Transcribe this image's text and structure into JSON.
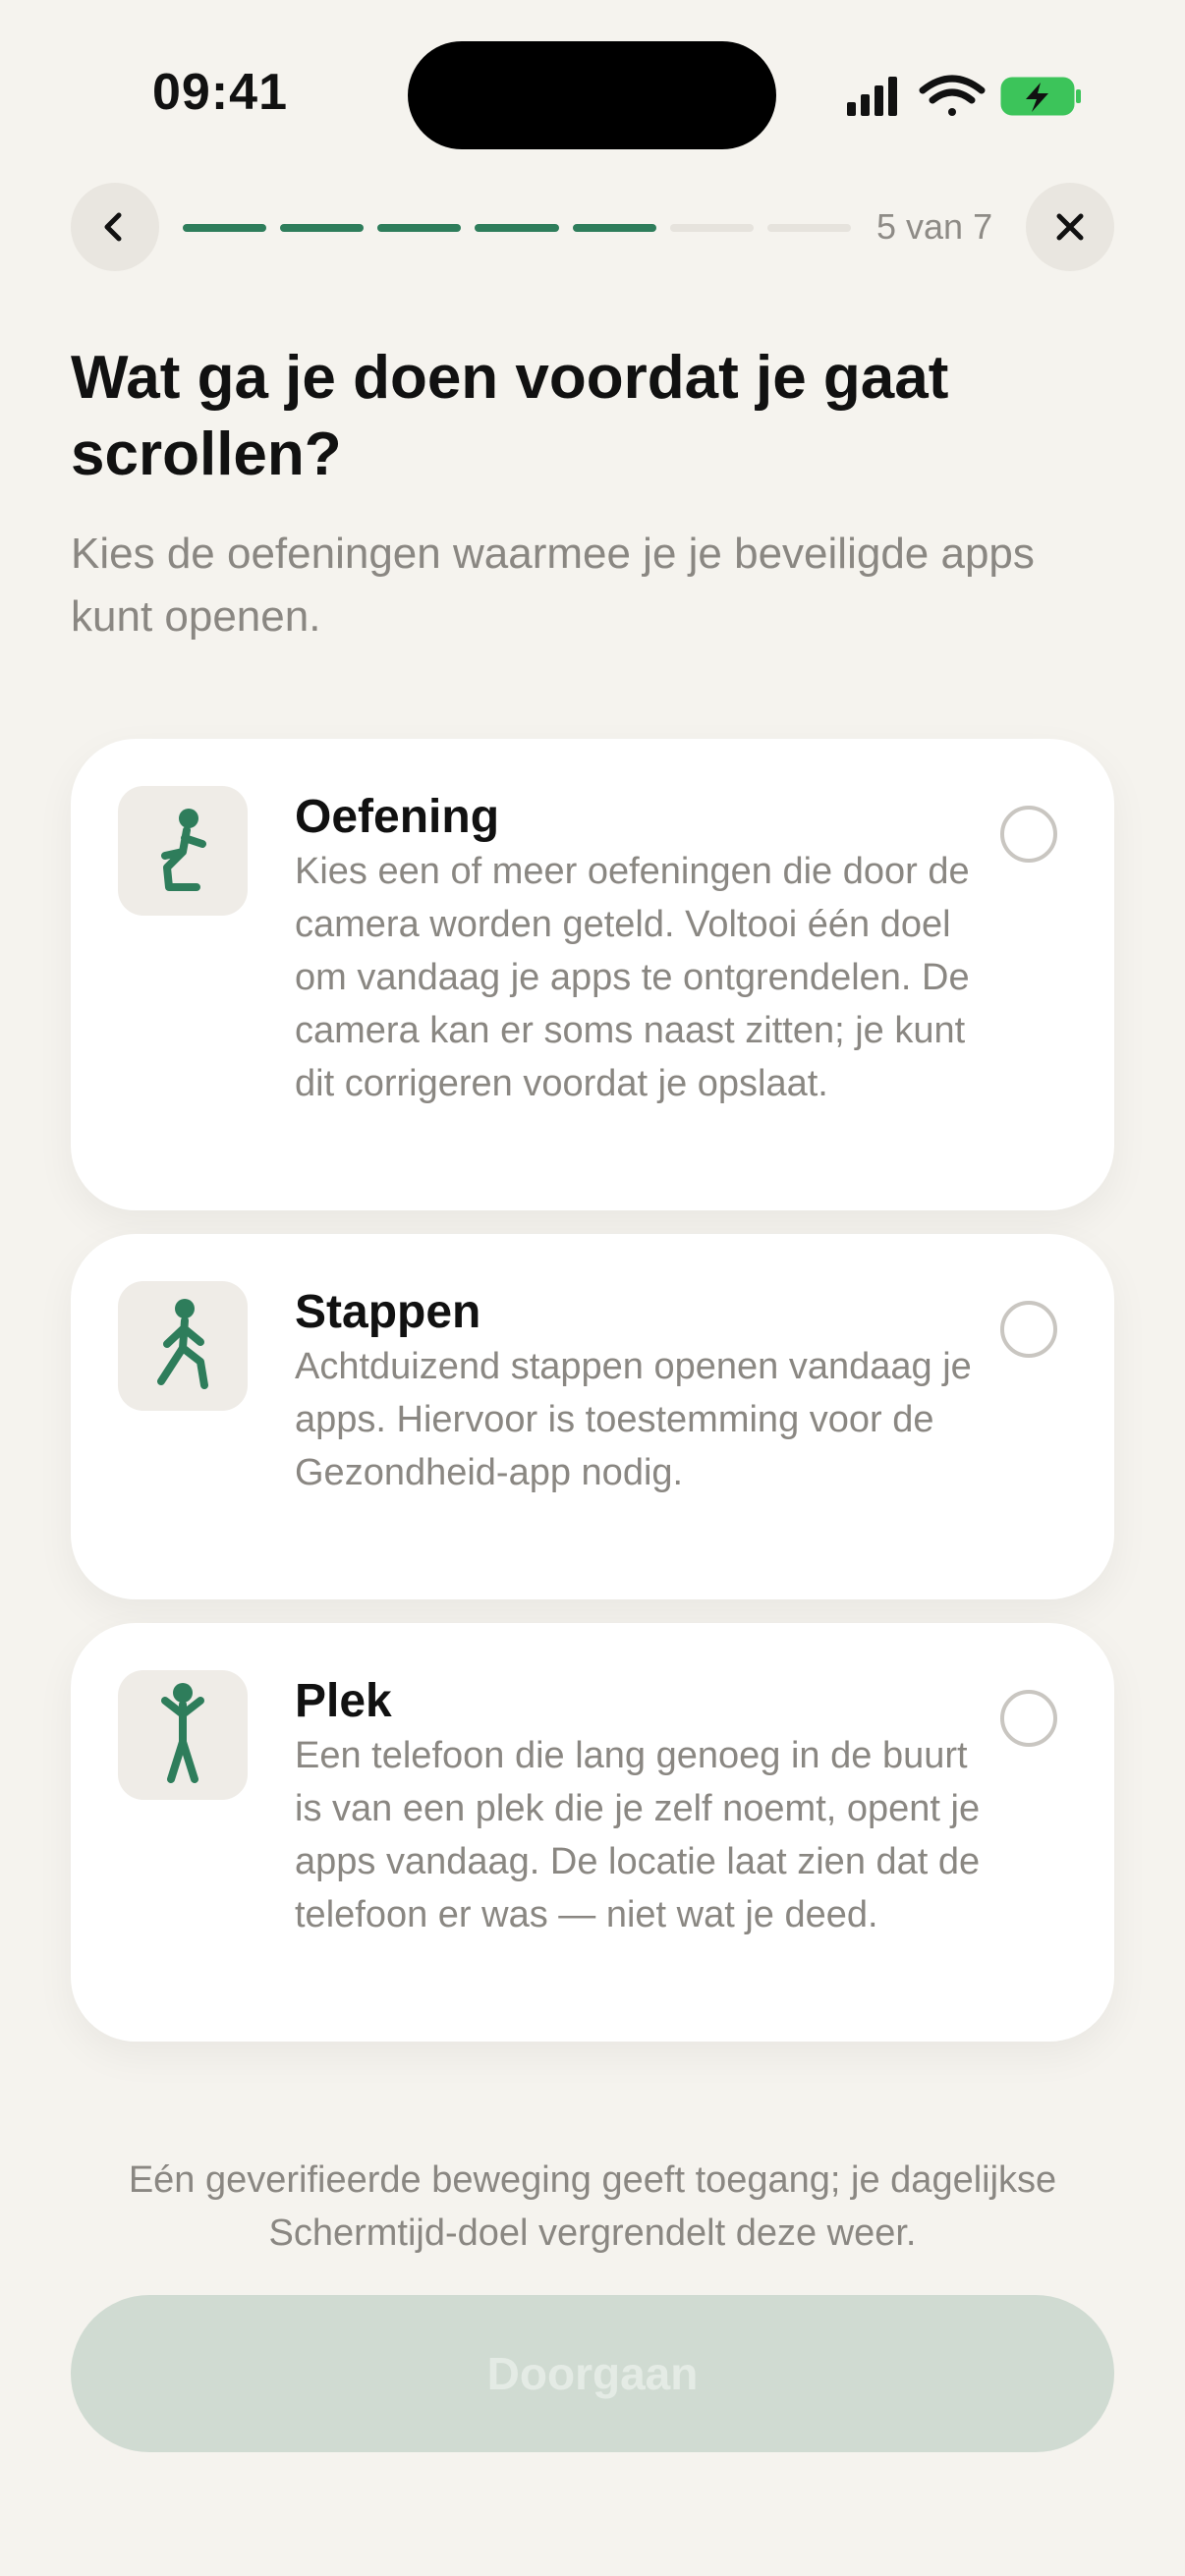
{
  "status_bar": {
    "time": "09:41",
    "icons": [
      "cellular-signal-icon",
      "wifi-icon",
      "battery-charging-icon"
    ]
  },
  "header": {
    "back_icon": "chevron-left-icon",
    "close_icon": "close-icon",
    "progress": {
      "current": 5,
      "total": 7
    },
    "step_label": "5 van 7"
  },
  "main": {
    "title": "Wat ga je doen voordat je gaat scrollen?",
    "subtitle": "Kies de oefeningen waarmee je je beveiligde apps kunt openen."
  },
  "options": [
    {
      "icon": "squat-figure-icon",
      "title": "Oefening",
      "description": "Kies een of meer oefeningen die door de camera worden geteld. Voltooi één doel om vandaag je apps te ontgrendelen. De camera kan er soms naast zitten; je kunt dit corrigeren voordat je opslaat.",
      "selected": false
    },
    {
      "icon": "walking-figure-icon",
      "title": "Stappen",
      "description": "Achtduizend stappen openen vandaag je apps. Hiervoor is toestemming voor de Gezondheid-app nodig.",
      "selected": false
    },
    {
      "icon": "standing-figure-icon",
      "title": "Plek",
      "description": "Een telefoon die lang genoeg in de buurt is van een plek die je zelf noemt, opent je apps vandaag. De locatie laat zien dat de telefoon er was — niet wat je deed.",
      "selected": false
    }
  ],
  "footer": {
    "note": "Eén geverifieerde beweging geeft toegang; je dagelijkse Schermtijd-doel vergrendelt deze weer.",
    "continue_label": "Doorgaan",
    "continue_enabled": false
  },
  "colors": {
    "background": "#F5F3EE",
    "accent": "#2E7D5B",
    "progress_inactive": "#E6E3DD",
    "button_disabled": "#D0DBD2",
    "secondary_text": "#8A8782"
  }
}
